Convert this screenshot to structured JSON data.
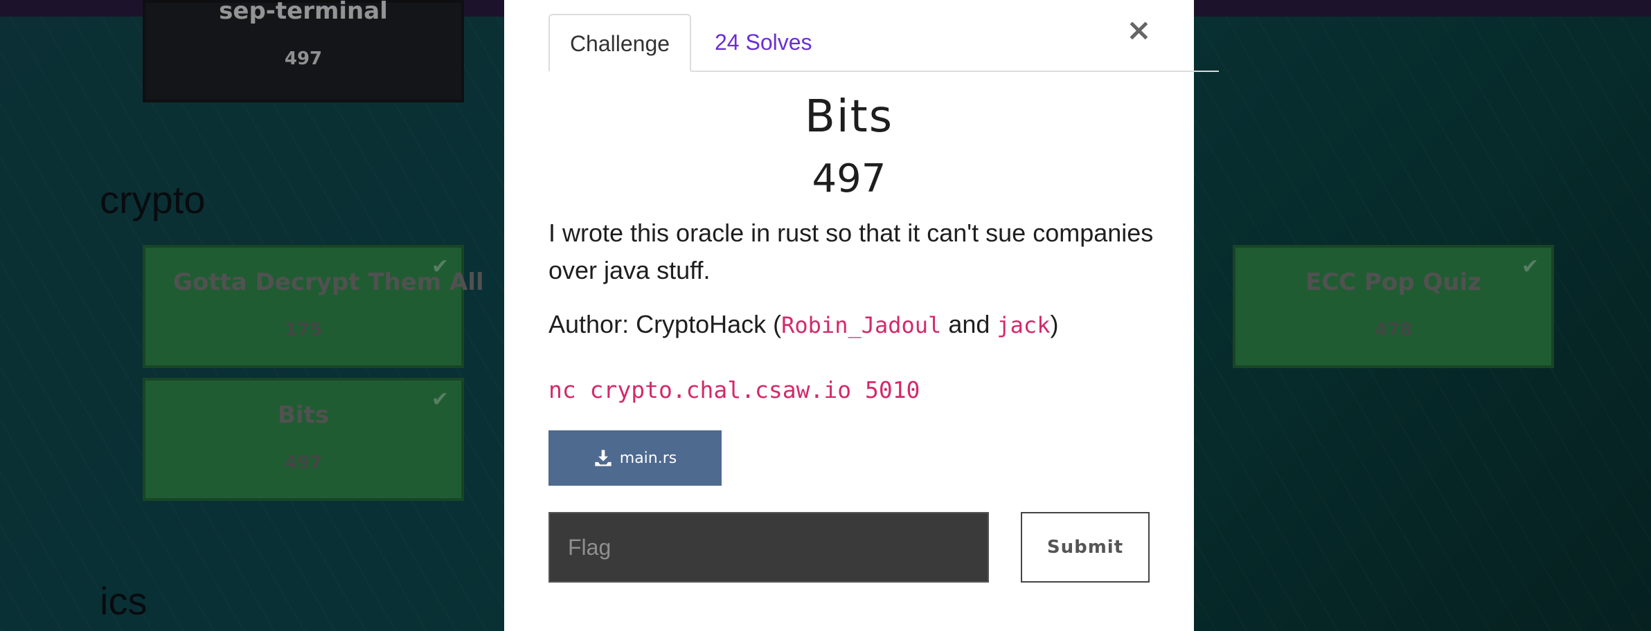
{
  "background": {
    "categories": [
      {
        "name": "crypto"
      },
      {
        "name": "ics"
      }
    ],
    "cards": [
      {
        "name": "sep-terminal",
        "value": "497",
        "style": "dark",
        "solved": false
      },
      {
        "name": "Gotta Decrypt Them All",
        "value": "175",
        "style": "green",
        "solved": true
      },
      {
        "name": "Bits",
        "value": "497",
        "style": "green",
        "solved": true
      },
      {
        "name": "ECC Pop Quiz",
        "value": "478",
        "style": "green",
        "solved": true
      }
    ]
  },
  "modal": {
    "tabs": [
      {
        "label": "Challenge",
        "active": true
      },
      {
        "label": "24 Solves",
        "active": false
      }
    ],
    "close_label": "×",
    "title": "Bits",
    "value": "497",
    "description": "I wrote this oracle in rust so that it can't sue companies over java stuff.",
    "author": {
      "prefix": "Author: CryptoHack (",
      "name1": "Robin_Jadoul",
      "joiner": " and ",
      "name2": "jack",
      "suffix": ")"
    },
    "command": "nc crypto.chal.csaw.io 5010",
    "file": {
      "label": "main.rs",
      "icon": "download-icon"
    },
    "flag_placeholder": "Flag",
    "submit_label": "Submit"
  },
  "colors": {
    "topbar": "#27183a",
    "link": "#6a2fd4",
    "code": "#d3296a",
    "file_button": "#4f6a8f",
    "solved_card": "#2b7b43"
  }
}
